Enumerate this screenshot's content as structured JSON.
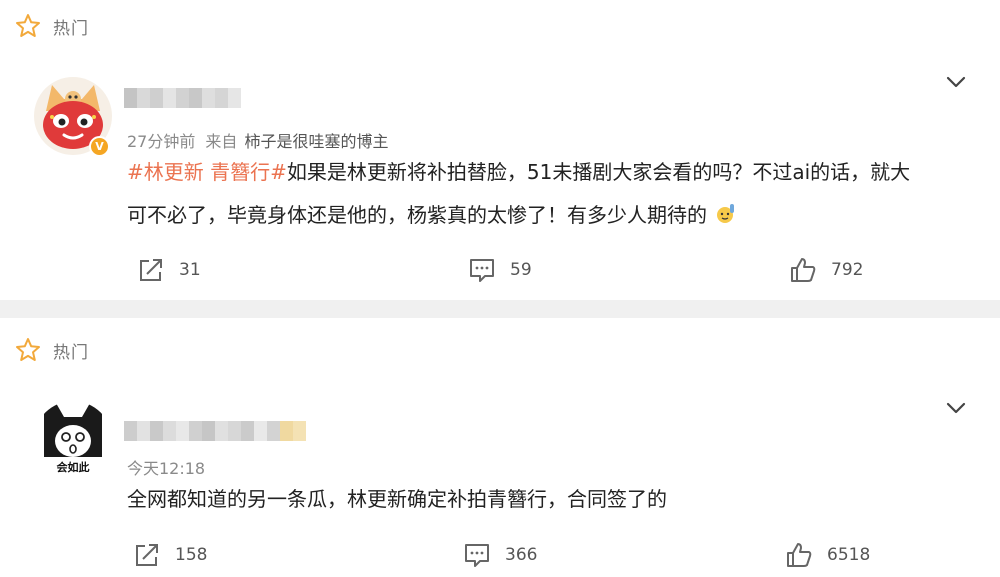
{
  "posts": [
    {
      "section_label": "热门",
      "time": "27分钟前",
      "source_prefix": "来自",
      "source_name": "柿子是很哇塞的博主",
      "topic": "#林更新 青簪行#",
      "text_line1": "如果是林更新将补拍替脸，51未播剧大家会看的吗？不过ai的话，就大",
      "text_line2": "可不必了，毕竟身体还是他的，杨紫真的太惨了！有多少人期待的",
      "badge": "V",
      "reposts": "31",
      "comments": "59",
      "likes": "792"
    },
    {
      "section_label": "热门",
      "time": "今天12:18",
      "text_line1": "全网都知道的另一条瓜，林更新确定补拍青簪行，合同签了的",
      "avatar_text": "会如此",
      "reposts": "158",
      "comments": "366",
      "likes": "6518"
    }
  ],
  "colors": {
    "topic": "#eb7350",
    "star": "#f2a93b",
    "badge": "#f5a623",
    "page_bg": "#f0f0f0"
  },
  "icons": [
    "star-icon",
    "chevron-down-icon",
    "repost-icon",
    "comment-icon",
    "like-icon",
    "raising-hand-emoji"
  ]
}
